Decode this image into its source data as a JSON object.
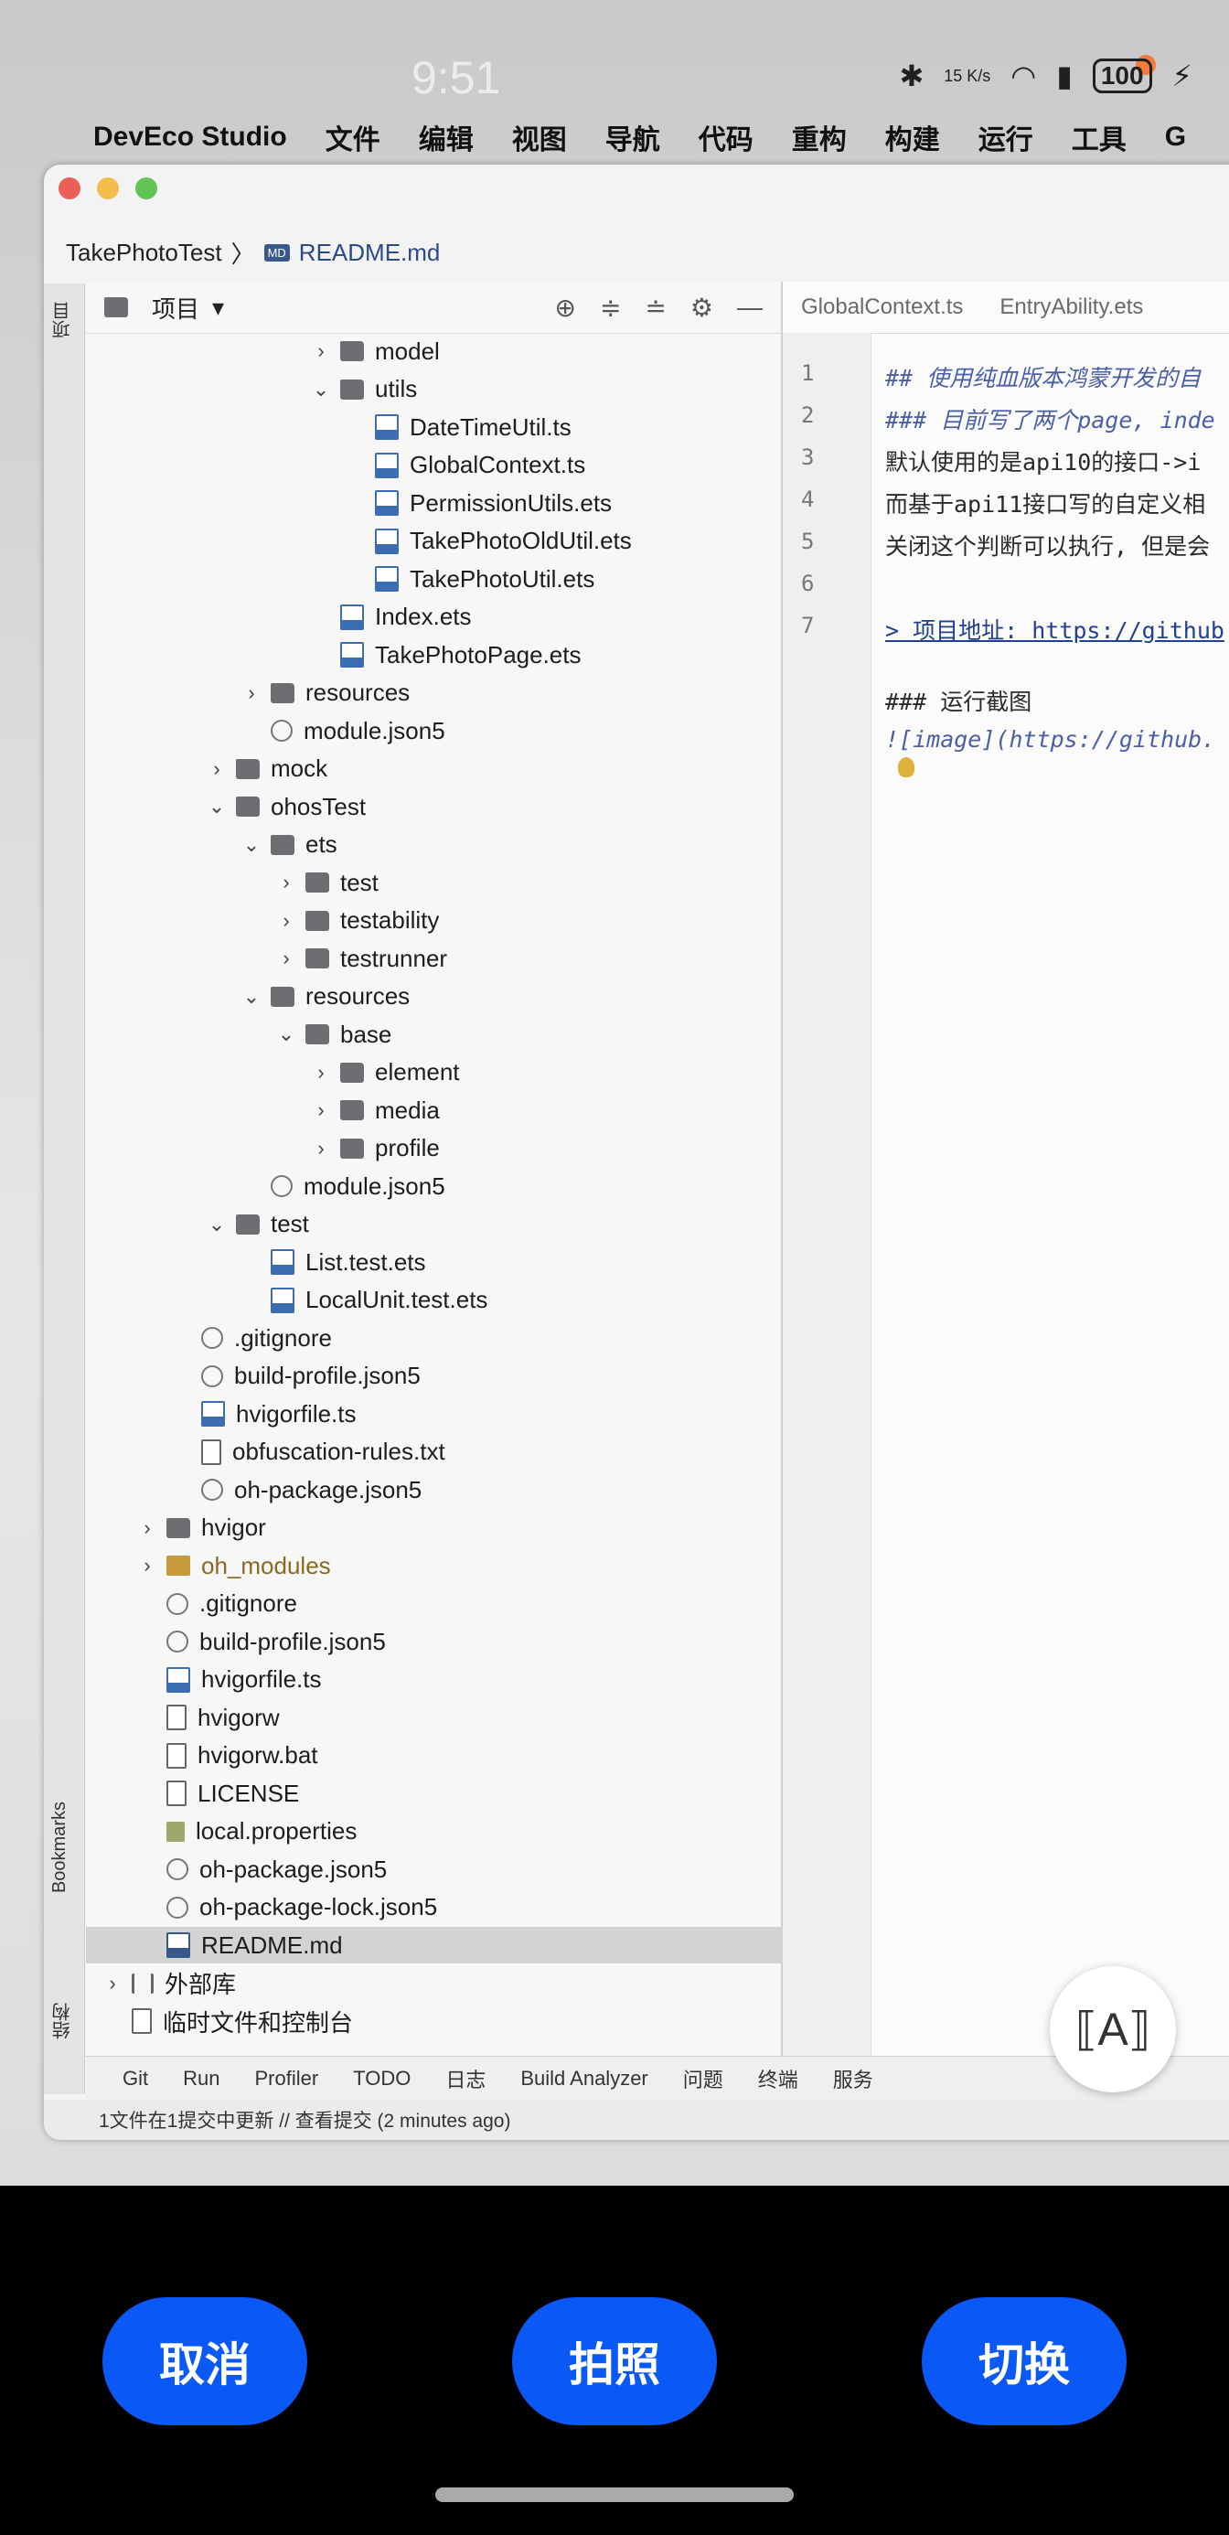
{
  "status": {
    "time": "9:51",
    "net_speed": "15 K/s",
    "battery": "100"
  },
  "menubar": {
    "items": [
      "DevEco Studio",
      "文件",
      "编辑",
      "视图",
      "导航",
      "代码",
      "重构",
      "构建",
      "运行",
      "工具",
      "G"
    ]
  },
  "breadcrumb": {
    "project": "TakePhotoTest",
    "file": "README.md"
  },
  "panel": {
    "title": "项目"
  },
  "left_strip": {
    "top_label": "项目",
    "bookmarks": "Bookmarks",
    "structure": "结构"
  },
  "tree": [
    {
      "label": "model",
      "icon": "folder",
      "depth": 7,
      "expander": ">"
    },
    {
      "label": "utils",
      "icon": "folder",
      "depth": 7,
      "expander": "v"
    },
    {
      "label": "DateTimeUtil.ts",
      "icon": "ts",
      "depth": 8,
      "expander": ""
    },
    {
      "label": "GlobalContext.ts",
      "icon": "ts",
      "depth": 8,
      "expander": ""
    },
    {
      "label": "PermissionUtils.ets",
      "icon": "ets",
      "depth": 8,
      "expander": ""
    },
    {
      "label": "TakePhotoOldUtil.ets",
      "icon": "ets",
      "depth": 8,
      "expander": ""
    },
    {
      "label": "TakePhotoUtil.ets",
      "icon": "ets",
      "depth": 8,
      "expander": ""
    },
    {
      "label": "Index.ets",
      "icon": "ets",
      "depth": 7,
      "expander": ""
    },
    {
      "label": "TakePhotoPage.ets",
      "icon": "ets",
      "depth": 7,
      "expander": ""
    },
    {
      "label": "resources",
      "icon": "folder",
      "depth": 5,
      "expander": ">"
    },
    {
      "label": "module.json5",
      "icon": "json",
      "depth": 5,
      "expander": ""
    },
    {
      "label": "mock",
      "icon": "folder",
      "depth": 4,
      "expander": ">"
    },
    {
      "label": "ohosTest",
      "icon": "folder",
      "depth": 4,
      "expander": "v"
    },
    {
      "label": "ets",
      "icon": "folder",
      "depth": 5,
      "expander": "v"
    },
    {
      "label": "test",
      "icon": "folder",
      "depth": 6,
      "expander": ">"
    },
    {
      "label": "testability",
      "icon": "folder",
      "depth": 6,
      "expander": ">"
    },
    {
      "label": "testrunner",
      "icon": "folder",
      "depth": 6,
      "expander": ">"
    },
    {
      "label": "resources",
      "icon": "folder",
      "depth": 5,
      "expander": "v"
    },
    {
      "label": "base",
      "icon": "folder",
      "depth": 6,
      "expander": "v"
    },
    {
      "label": "element",
      "icon": "folder",
      "depth": 7,
      "expander": ">"
    },
    {
      "label": "media",
      "icon": "folder",
      "depth": 7,
      "expander": ">"
    },
    {
      "label": "profile",
      "icon": "folder",
      "depth": 7,
      "expander": ">"
    },
    {
      "label": "module.json5",
      "icon": "json",
      "depth": 5,
      "expander": ""
    },
    {
      "label": "test",
      "icon": "folder",
      "depth": 4,
      "expander": "v"
    },
    {
      "label": "List.test.ets",
      "icon": "ets",
      "depth": 5,
      "expander": ""
    },
    {
      "label": "LocalUnit.test.ets",
      "icon": "ets",
      "depth": 5,
      "expander": ""
    },
    {
      "label": ".gitignore",
      "icon": "json",
      "depth": 3,
      "expander": ""
    },
    {
      "label": "build-profile.json5",
      "icon": "json",
      "depth": 3,
      "expander": ""
    },
    {
      "label": "hvigorfile.ts",
      "icon": "ts",
      "depth": 3,
      "expander": ""
    },
    {
      "label": "obfuscation-rules.txt",
      "icon": "file",
      "depth": 3,
      "expander": ""
    },
    {
      "label": "oh-package.json5",
      "icon": "json",
      "depth": 3,
      "expander": ""
    },
    {
      "label": "hvigor",
      "icon": "folder",
      "depth": 2,
      "expander": ">"
    },
    {
      "label": "oh_modules",
      "icon": "folder-y",
      "depth": 2,
      "expander": ">"
    },
    {
      "label": ".gitignore",
      "icon": "json",
      "depth": 2,
      "expander": ""
    },
    {
      "label": "build-profile.json5",
      "icon": "json",
      "depth": 2,
      "expander": ""
    },
    {
      "label": "hvigorfile.ts",
      "icon": "ts",
      "depth": 2,
      "expander": ""
    },
    {
      "label": "hvigorw",
      "icon": "file",
      "depth": 2,
      "expander": ""
    },
    {
      "label": "hvigorw.bat",
      "icon": "file",
      "depth": 2,
      "expander": ""
    },
    {
      "label": "LICENSE",
      "icon": "file",
      "depth": 2,
      "expander": ""
    },
    {
      "label": "local.properties",
      "icon": "props",
      "depth": 2,
      "expander": ""
    },
    {
      "label": "oh-package.json5",
      "icon": "json",
      "depth": 2,
      "expander": ""
    },
    {
      "label": "oh-package-lock.json5",
      "icon": "json",
      "depth": 2,
      "expander": ""
    },
    {
      "label": "README.md",
      "icon": "md",
      "depth": 2,
      "expander": "",
      "selected": true
    },
    {
      "label": "外部库",
      "icon": "lib",
      "depth": 1,
      "expander": ">"
    },
    {
      "label": "临时文件和控制台",
      "icon": "file",
      "depth": 1,
      "expander": ""
    }
  ],
  "editor": {
    "tabs": [
      "GlobalContext.ts",
      "EntryAbility.ets"
    ],
    "line_numbers": [
      "1",
      "2",
      "3",
      "4",
      "5",
      "6",
      "7"
    ],
    "lines": [
      "## 使用纯血版本鸿蒙开发的自",
      "### 目前写了两个page, inde",
      "默认使用的是api10的接口->i",
      "而基于api11接口写的自定义相",
      "关闭这个判断可以执行, 但是会",
      "",
      "> 项目地址: https://github"
    ],
    "extra": [
      "### 运行截图",
      "![image](https://github."
    ]
  },
  "bottom_toolbar": [
    "Git",
    "Run",
    "Profiler",
    "TODO",
    "日志",
    "Build Analyzer",
    "问题",
    "终端",
    "服务"
  ],
  "status_line": "1文件在1提交中更新 // 查看提交 (2 minutes ago)",
  "camera": {
    "cancel": "取消",
    "shoot": "拍照",
    "switch": "切换"
  }
}
